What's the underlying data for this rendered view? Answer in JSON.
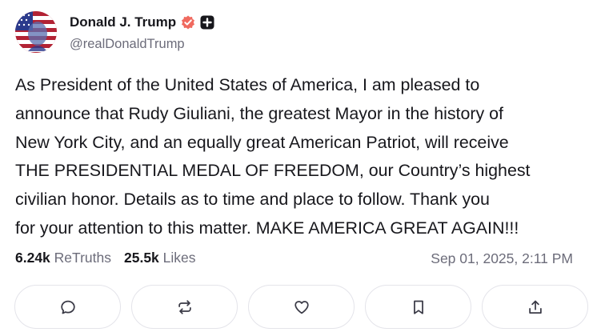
{
  "author": {
    "display_name": "Donald J. Trump",
    "handle": "@realDonaldTrump",
    "avatar_icon": "flag-portrait-avatar",
    "verified_badge": "verified-check-icon",
    "verified_color": "#f06a5f",
    "plus_badge": "plus-badge-icon"
  },
  "post": {
    "lines": [
      "As President of the United States of America, I am pleased to",
      "announce that Rudy Giuliani, the greatest Mayor in the history of",
      "New York City, and an equally great American Patriot, will receive",
      "THE PRESIDENTIAL MEDAL OF FREEDOM, our Country’s highest",
      "civilian honor. Details as to time and place to follow. Thank you",
      "for your attention to this matter.  MAKE AMERICA GREAT AGAIN!!!"
    ]
  },
  "stats": {
    "retruths_count": "6.24k",
    "retruths_label": "ReTruths",
    "likes_count": "25.5k",
    "likes_label": "Likes"
  },
  "timestamp": "Sep 01, 2025, 2:11 PM",
  "actions": [
    {
      "icon": "reply-icon"
    },
    {
      "icon": "retruth-icon"
    },
    {
      "icon": "heart-icon"
    },
    {
      "icon": "bookmark-icon"
    },
    {
      "icon": "share-icon"
    }
  ]
}
